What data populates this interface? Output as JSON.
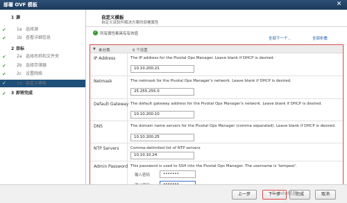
{
  "window": {
    "title": "部署 OVF 模板",
    "close_glyph": "✕"
  },
  "steps": [
    {
      "num": "1",
      "label": "源",
      "level": "major",
      "checked": false,
      "active": false
    },
    {
      "num": "1a",
      "label": "选择源",
      "level": "sub",
      "checked": true,
      "active": false
    },
    {
      "num": "1b",
      "label": "查看详细信息",
      "level": "sub",
      "checked": true,
      "active": false
    },
    {
      "num": "2",
      "label": "目标",
      "level": "major",
      "checked": false,
      "active": false
    },
    {
      "num": "2a",
      "label": "选择名称和文件夹",
      "level": "sub",
      "checked": true,
      "active": false
    },
    {
      "num": "2b",
      "label": "选择存储器",
      "level": "sub",
      "checked": true,
      "active": false
    },
    {
      "num": "2c",
      "label": "设置网络",
      "level": "sub",
      "checked": true,
      "active": false
    },
    {
      "num": "2d",
      "label": "自定义模板",
      "level": "sub",
      "checked": true,
      "active": true
    },
    {
      "num": "3",
      "label": "即将完成",
      "level": "major",
      "checked": true,
      "active": false
    }
  ],
  "content": {
    "heading": "自定义模板",
    "subheading": "自定义该软件解决方案的部署属性",
    "notice": "所有属性都具有有效值",
    "link_collapse": "全部下一个...",
    "link_expand": "全部折叠",
    "category": {
      "name": "未分类",
      "count": "6 个设置"
    },
    "properties": [
      {
        "name": "IP Address",
        "desc": "The IP address for the Pivotal Ops Manager. Leave blank if DHCP is desired.",
        "value": "10.10.200.21"
      },
      {
        "name": "Netmask",
        "desc": "The netmask for the Pivotal Ops Manager's network. Leave blank if DHCP is desired.",
        "value": "25.255.255.0"
      },
      {
        "name": "Default Gateway",
        "desc": "The default gateway address for the Pivotal Ops Manager's network. Leave blank if DHCP is desired.",
        "value": "10.10.200.10"
      },
      {
        "name": "DNS",
        "desc": "The domain name servers for the Pivotal Ops Manager (comma separated). Leave blank if DHCP is desired.",
        "value": "10.10.200.25"
      },
      {
        "name": "NTP Servers",
        "desc": "Comma-delimited list of NTP servers",
        "value": "10.10.10.24"
      },
      {
        "name": "Admin Password",
        "desc": "This password is used to SSH into the Pivotal Ops Manager. The username is 'tempest'.",
        "value": ""
      }
    ],
    "password": {
      "enter_label": "输入密码",
      "enter_value": "•••••••",
      "confirm_label": "确认密码",
      "confirm_value": "•••••••"
    }
  },
  "buttons": {
    "back": "上一步",
    "next": "下一步",
    "finish": "完成",
    "cancel": "取消"
  },
  "watermark": "Baidu经验",
  "colors": {
    "titlebar": "#1c3a5c",
    "active_step": "#1e4f79",
    "check": "#2c9b2c",
    "highlight": "#d94848",
    "link": "#1a5ea8"
  }
}
